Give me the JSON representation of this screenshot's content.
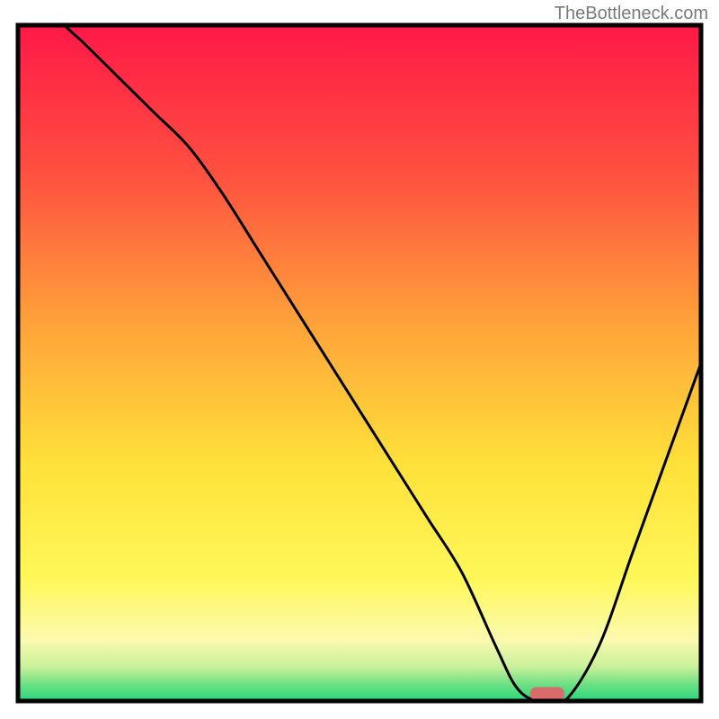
{
  "watermark": "TheBottleneck.com",
  "chart_data": {
    "type": "line",
    "title": "",
    "xlabel": "",
    "ylabel": "",
    "xlim": [
      0,
      100
    ],
    "ylim": [
      0,
      100
    ],
    "x": [
      0,
      5,
      10,
      15,
      20,
      25,
      30,
      35,
      40,
      45,
      50,
      55,
      60,
      65,
      70,
      73,
      76,
      80,
      85,
      90,
      95,
      100
    ],
    "values": [
      110,
      102,
      97,
      92,
      87,
      82,
      75,
      67,
      59,
      51,
      43,
      35,
      27,
      19,
      8,
      2,
      0,
      0,
      8,
      22,
      36,
      50
    ],
    "marker": {
      "x_start": 75,
      "x_end": 80,
      "y": 1
    }
  },
  "colors": {
    "gradient_top": "#ff1848",
    "gradient_mid1": "#ff6a3a",
    "gradient_mid2": "#ffc639",
    "gradient_mid3": "#fff53b",
    "gradient_bottom_yellow": "#fdfca6",
    "gradient_green_light": "#9de97e",
    "gradient_green": "#28d67c",
    "border": "#000000",
    "curve": "#000000",
    "marker": "#d86b6b"
  }
}
